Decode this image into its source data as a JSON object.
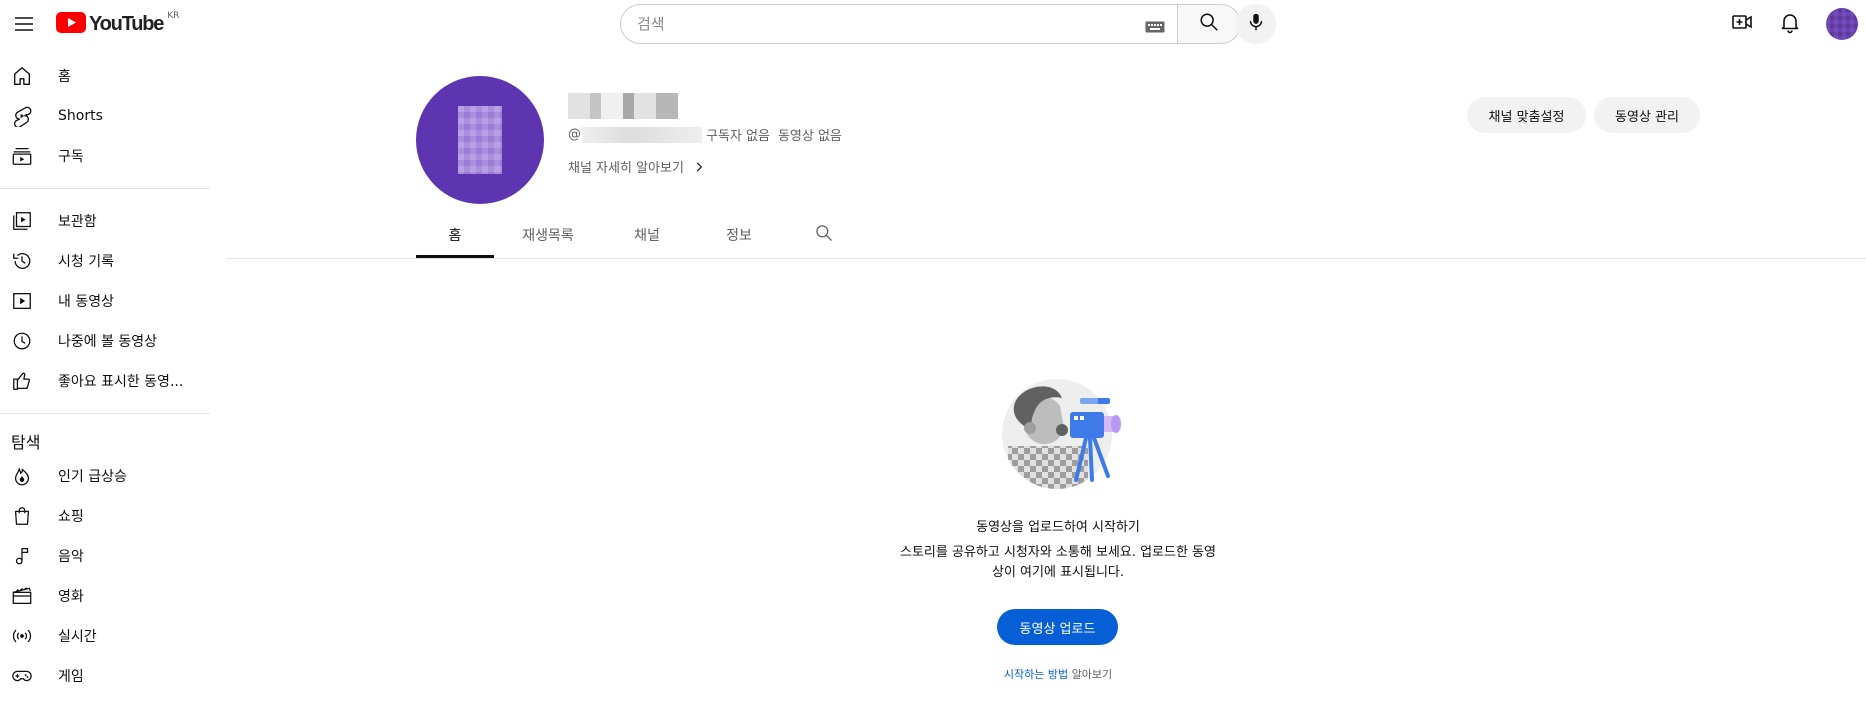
{
  "header": {
    "logo_text": "YouTube",
    "region": "KR",
    "search_placeholder": "검색",
    "icons": [
      "menu-icon",
      "youtube-logo-icon",
      "keyboard-icon",
      "search-icon",
      "mic-icon",
      "create-video-icon",
      "notifications-icon"
    ]
  },
  "sidebar": {
    "section1": [
      {
        "label": "홈",
        "icon": "home-icon"
      },
      {
        "label": "Shorts",
        "icon": "shorts-icon"
      },
      {
        "label": "구독",
        "icon": "subscriptions-icon"
      }
    ],
    "section2": [
      {
        "label": "보관함",
        "icon": "library-icon"
      },
      {
        "label": "시청 기록",
        "icon": "history-icon"
      },
      {
        "label": "내 동영상",
        "icon": "your-videos-icon"
      },
      {
        "label": "나중에 볼 동영상",
        "icon": "watch-later-icon"
      },
      {
        "label": "좋아요 표시한 동영...",
        "icon": "liked-icon"
      }
    ],
    "explore_heading": "탐색",
    "section3": [
      {
        "label": "인기 급상승",
        "icon": "trending-icon"
      },
      {
        "label": "쇼핑",
        "icon": "shopping-icon"
      },
      {
        "label": "음악",
        "icon": "music-icon"
      },
      {
        "label": "영화",
        "icon": "movies-icon"
      },
      {
        "label": "실시간",
        "icon": "live-icon"
      },
      {
        "label": "게임",
        "icon": "gaming-icon"
      }
    ]
  },
  "channel": {
    "handle_prefix": "@",
    "subscribers": "구독자 없음",
    "videos": "동영상 없음",
    "more_about": "채널 자세히 알아보기",
    "customize_button": "채널 맞춤설정",
    "manage_button": "동영상 관리"
  },
  "tabs": [
    {
      "label": "홈",
      "active": true
    },
    {
      "label": "재생목록",
      "active": false
    },
    {
      "label": "채널",
      "active": false
    },
    {
      "label": "정보",
      "active": false
    }
  ],
  "empty_state": {
    "title": "동영상을 업로드하여 시작하기",
    "description": "스토리를 공유하고 시청자와 소통해 보세요. 업로드한 동영상이 여기에 표시됩니다.",
    "upload_button": "동영상 업로드",
    "learn_link": "시작하는 방법",
    "learn_suffix": " 알아보기"
  },
  "colors": {
    "brand_red": "#ff0000",
    "primary_blue": "#065fd4",
    "avatar_purple": "#5e35b1",
    "pill_bg": "#f2f2f2",
    "secondary_text": "#606060"
  }
}
